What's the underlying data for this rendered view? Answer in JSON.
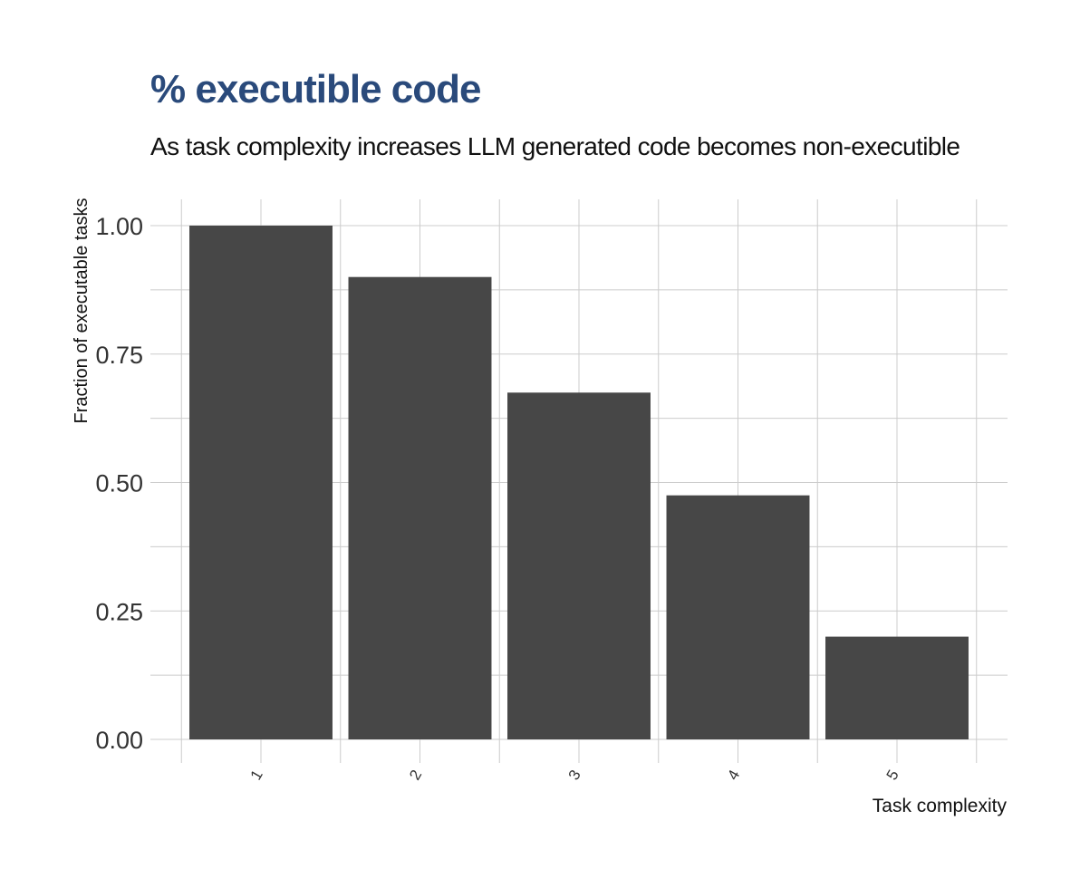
{
  "chart_data": {
    "type": "bar",
    "title": "% executible code",
    "subtitle": "As task complexity increases LLM generated code becomes non-executible",
    "xlabel": "Task complexity",
    "ylabel": "Fraction of executable tasks",
    "categories": [
      "1",
      "2",
      "3",
      "4",
      "5"
    ],
    "values": [
      1.0,
      0.9,
      0.675,
      0.475,
      0.2
    ],
    "ylim": [
      0,
      1.05
    ],
    "yticks": [
      "0.00",
      "0.25",
      "0.50",
      "0.75",
      "1.00"
    ],
    "grid": true,
    "legend": "none",
    "colors": {
      "bar": "#474747",
      "title": "#2a4a7b",
      "grid": "#cccccc",
      "text": "#333333"
    }
  }
}
